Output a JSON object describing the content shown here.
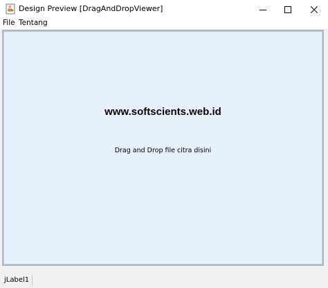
{
  "window": {
    "title": "Design Preview [DragAndDropViewer]",
    "icon": "java-cup-icon",
    "controls": [
      "minimize-icon",
      "maximize-icon",
      "close-icon"
    ]
  },
  "menu": {
    "items": [
      "File",
      "Tentang"
    ]
  },
  "dropzone": {
    "heading": "www.softscients.web.id",
    "hint": "Drag and Drop file citra disini",
    "background_color": "#e6f1fb"
  },
  "status": {
    "label": "jLabel1"
  }
}
